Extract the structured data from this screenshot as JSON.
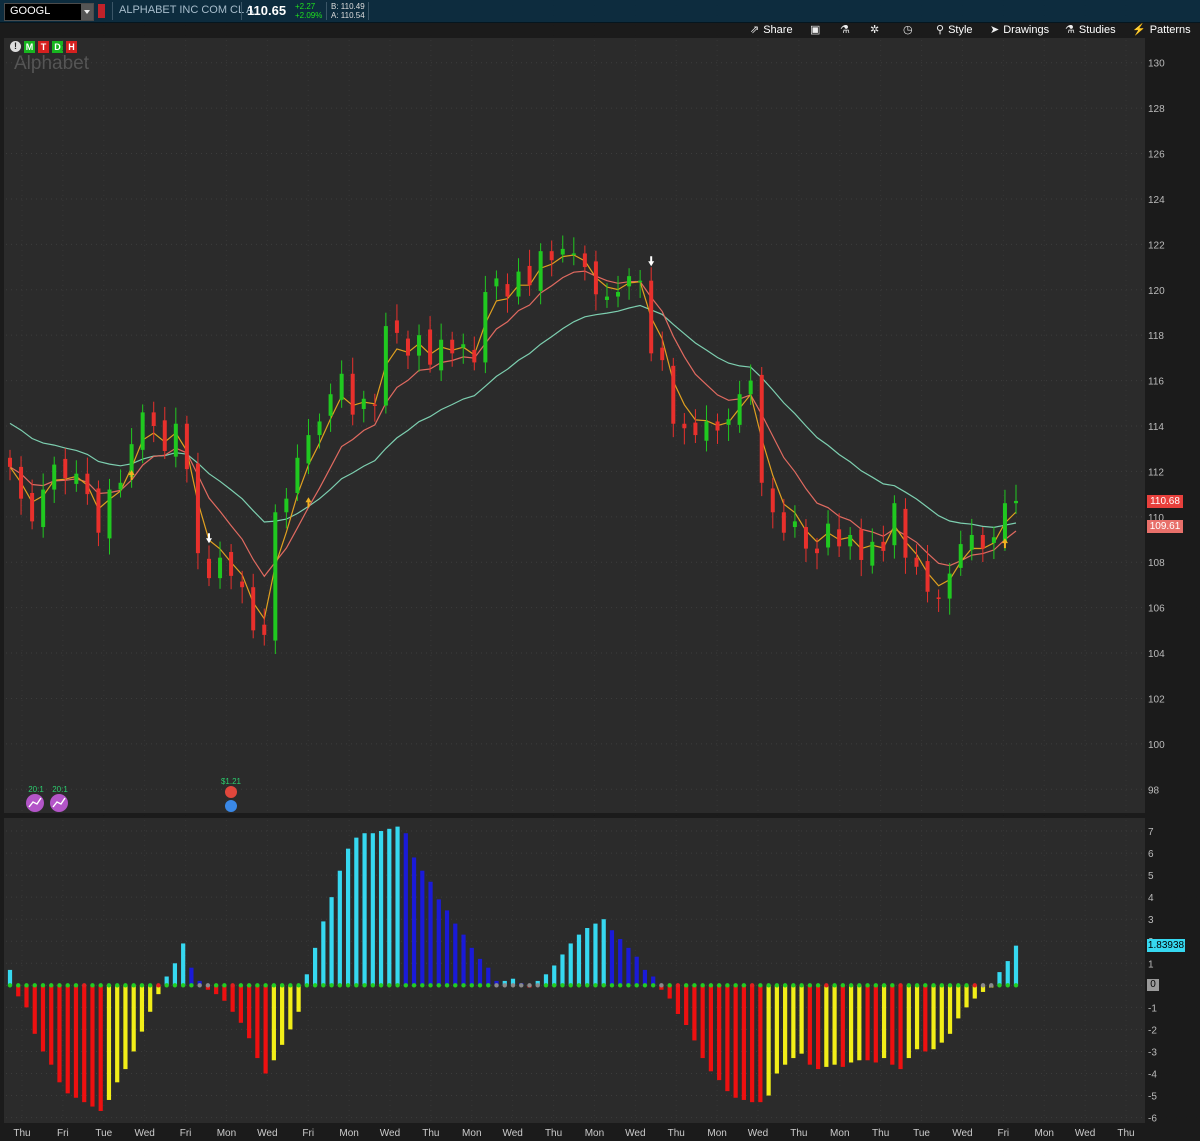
{
  "header": {
    "symbol": "GOOGL",
    "description": "ALPHABET INC COM CL A",
    "last": "110.65",
    "change": "+2.27",
    "change_pct": "+2.09%",
    "bid": "B: 110.49",
    "ask": "A: 110.54"
  },
  "toolbar": {
    "share": "Share",
    "style": "Style",
    "drawings": "Drawings",
    "studies": "Studies",
    "patterns": "Patterns"
  },
  "aggregation_buttons": [
    "M",
    "T",
    "D",
    "H"
  ],
  "watermark": "Alphabet",
  "events": {
    "split_1": "20:1",
    "split_2": "20:1",
    "dividend": "$1.21"
  },
  "price_tags": {
    "last": "110.68",
    "avg": "109.61"
  },
  "osc_tag": "1.83938",
  "osc_zero_tag": "0",
  "colors": {
    "up": "#20c820",
    "down": "#e8302c",
    "ema_fast": "#e0a020",
    "ema_mid": "#e06a60",
    "ema_slow": "#7dcfb0",
    "hist_cyan": "#36d8f0",
    "hist_blue": "#1a1ad8",
    "hist_red": "#ee1010",
    "hist_yellow": "#f2ee18"
  },
  "chart_data": [
    {
      "type": "candlestick",
      "ylim": [
        97,
        131
      ],
      "yticks": [
        98,
        100,
        102,
        104,
        106,
        108,
        110,
        112,
        114,
        116,
        118,
        120,
        122,
        124,
        126,
        128,
        130
      ],
      "x_labels": [
        "Thu",
        "Fri",
        "Tue",
        "Wed",
        "Fri",
        "Mon",
        "Wed",
        "Fri",
        "Mon",
        "Wed",
        "Thu",
        "Mon",
        "Wed",
        "Thu",
        "Mon",
        "Wed",
        "Thu",
        "Mon",
        "Wed",
        "Thu",
        "Mon",
        "Thu",
        "Tue",
        "Wed",
        "Fri",
        "Mon",
        "Wed",
        "Thu"
      ],
      "closes": [
        112.2,
        110.8,
        109.8,
        111.2,
        112.3,
        111.7,
        111.9,
        111.0,
        109.3,
        111.2,
        111.5,
        113.2,
        114.6,
        114.0,
        112.9,
        114.1,
        112.1,
        108.4,
        107.3,
        108.2,
        107.4,
        106.9,
        105.0,
        104.8,
        110.2,
        110.8,
        112.6,
        113.6,
        114.2,
        115.4,
        116.3,
        114.5,
        115.2,
        114.9,
        118.4,
        118.1,
        117.1,
        118.0,
        116.7,
        117.8,
        117.2,
        117.6,
        116.8,
        119.9,
        120.5,
        119.7,
        120.8,
        120.2,
        121.7,
        121.3,
        121.8,
        121.6,
        121.0,
        119.8,
        119.7,
        119.9,
        120.6,
        120.4,
        117.2,
        116.9,
        114.1,
        113.9,
        113.6,
        114.2,
        113.8,
        114.3,
        115.4,
        116.0,
        111.5,
        110.2,
        109.3,
        109.8,
        108.6,
        108.4,
        109.7,
        108.7,
        109.2,
        108.1,
        108.9,
        108.5,
        110.6,
        108.2,
        107.8,
        106.7,
        106.4,
        107.5,
        108.8,
        109.2,
        108.6,
        109.1,
        110.6,
        110.7
      ],
      "ema_fast_last": 110.2,
      "ema_mid_last": 109.6,
      "ema_slow_last": 109.5
    },
    {
      "type": "histogram",
      "ylim": [
        -6.2,
        7.5
      ],
      "yticks": [
        7,
        6,
        5,
        4,
        3,
        2,
        1,
        0,
        -1,
        -2,
        -3,
        -4,
        -5,
        -6
      ],
      "values": [
        0.7,
        -0.5,
        -1.0,
        -2.2,
        -3.0,
        -3.6,
        -4.4,
        -4.9,
        -5.1,
        -5.3,
        -5.5,
        -5.7,
        -5.2,
        -4.4,
        -3.8,
        -3.0,
        -2.1,
        -1.2,
        -0.4,
        0.4,
        1.0,
        1.9,
        0.8,
        0.2,
        -0.2,
        -0.4,
        -0.7,
        -1.2,
        -1.7,
        -2.4,
        -3.3,
        -4.0,
        -3.4,
        -2.7,
        -2.0,
        -1.2,
        0.5,
        1.7,
        2.9,
        4.0,
        5.2,
        6.2,
        6.7,
        6.9,
        6.9,
        7.0,
        7.1,
        7.2,
        6.9,
        5.8,
        5.2,
        4.7,
        3.9,
        3.4,
        2.8,
        2.3,
        1.7,
        1.2,
        0.8,
        0.2,
        0.2,
        0.3,
        0.1,
        -0.1,
        0.2,
        0.5,
        0.9,
        1.4,
        1.9,
        2.3,
        2.6,
        2.8,
        3.0,
        2.5,
        2.1,
        1.7,
        1.3,
        0.7,
        0.4,
        -0.2,
        -0.6,
        -1.3,
        -1.8,
        -2.5,
        -3.3,
        -3.9,
        -4.3,
        -4.8,
        -5.1,
        -5.2,
        -5.3,
        -5.3,
        -5.0,
        -4.0,
        -3.6,
        -3.3,
        -3.1,
        -3.6,
        -3.8,
        -3.7,
        -3.6,
        -3.7,
        -3.5,
        -3.4,
        -3.4,
        -3.5,
        -3.3,
        -3.6,
        -3.8,
        -3.3,
        -2.9,
        -3.0,
        -2.9,
        -2.6,
        -2.2,
        -1.5,
        -1.0,
        -0.6,
        -0.3,
        -0.1,
        0.6,
        1.1,
        1.8
      ]
    }
  ]
}
